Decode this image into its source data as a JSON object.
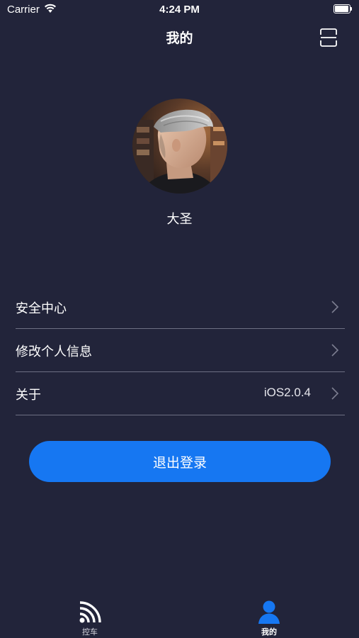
{
  "status_bar": {
    "carrier": "Carrier",
    "time": "4:24 PM"
  },
  "nav": {
    "title": "我的",
    "right_icon": "scan-icon"
  },
  "profile": {
    "username": "大圣"
  },
  "menu": {
    "items": [
      {
        "label": "安全中心",
        "value": ""
      },
      {
        "label": "修改个人信息",
        "value": ""
      },
      {
        "label": "关于",
        "value": "iOS2.0.4"
      }
    ]
  },
  "logout": {
    "label": "退出登录"
  },
  "tabs": [
    {
      "label": "控车",
      "icon": "signal-icon",
      "active": false
    },
    {
      "label": "我的",
      "icon": "user-icon",
      "active": true
    }
  ],
  "colors": {
    "background": "#22243a",
    "accent": "#1677f2",
    "divider": "#6e7083",
    "active_tab": "#1677f2"
  }
}
